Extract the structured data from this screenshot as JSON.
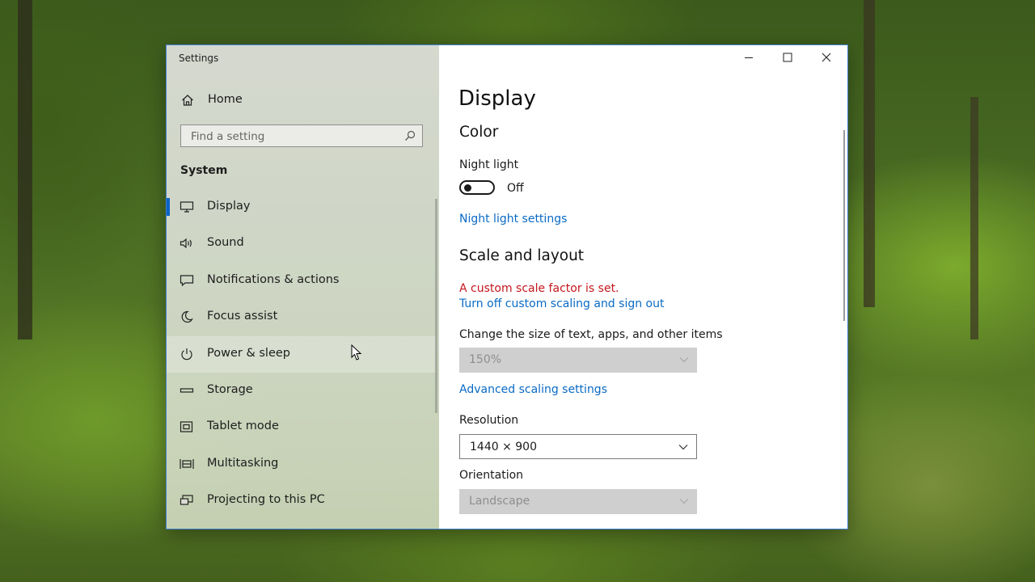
{
  "window": {
    "app_title": "Settings"
  },
  "sidebar": {
    "home_label": "Home",
    "search_placeholder": "Find a setting",
    "section_heading": "System",
    "items": [
      {
        "label": "Display",
        "icon": "monitor-icon",
        "active": true
      },
      {
        "label": "Sound",
        "icon": "speaker-icon"
      },
      {
        "label": "Notifications & actions",
        "icon": "message-icon"
      },
      {
        "label": "Focus assist",
        "icon": "moon-icon"
      },
      {
        "label": "Power & sleep",
        "icon": "power-icon"
      },
      {
        "label": "Storage",
        "icon": "storage-icon"
      },
      {
        "label": "Tablet mode",
        "icon": "tablet-icon"
      },
      {
        "label": "Multitasking",
        "icon": "multitasking-icon"
      },
      {
        "label": "Projecting to this PC",
        "icon": "projector-icon"
      }
    ]
  },
  "content": {
    "page_title": "Display",
    "color_heading": "Color",
    "night_light_label": "Night light",
    "night_light_state": "Off",
    "night_light_settings_link": "Night light settings",
    "scale_heading": "Scale and layout",
    "custom_scale_warning": "A custom scale factor is set.",
    "turn_off_scaling_link": "Turn off custom scaling and sign out",
    "text_size_label": "Change the size of text, apps, and other items",
    "text_size_value": "150%",
    "advanced_scaling_link": "Advanced scaling settings",
    "resolution_label": "Resolution",
    "resolution_value": "1440 × 900",
    "orientation_label": "Orientation",
    "orientation_value": "Landscape"
  },
  "colors": {
    "accent": "#0a64c8",
    "link": "#0a6ac4",
    "warning": "#c4161c"
  }
}
